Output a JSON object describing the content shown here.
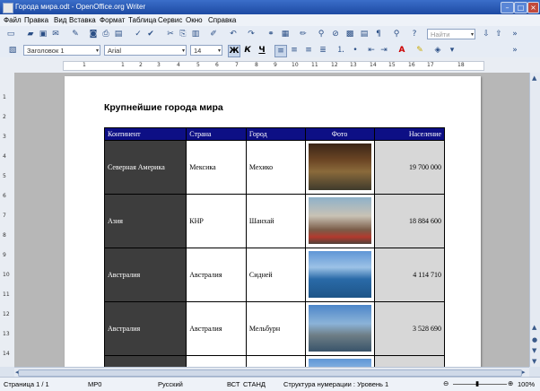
{
  "window": {
    "title": "Города мира.odt - OpenOffice.org Writer"
  },
  "menu": [
    "Файл",
    "Правка",
    "Вид",
    "Вставка",
    "Формат",
    "Таблица",
    "Сервис",
    "Окно",
    "Справка"
  ],
  "toolbar": {
    "find_placeholder": "Найти",
    "style_value": "Заголовок 1",
    "font_value": "Arial",
    "size_value": "14",
    "bold_label": "Ж",
    "italic_label": "К",
    "underline_label": "Ч"
  },
  "ruler": {
    "h_marks": [
      "1",
      "1",
      "2",
      "3",
      "4",
      "5",
      "6",
      "7",
      "8",
      "9",
      "10",
      "11",
      "12",
      "13",
      "14",
      "15",
      "16",
      "17",
      "18"
    ],
    "v_marks": [
      "1",
      "2",
      "3",
      "4",
      "5",
      "6",
      "7",
      "8",
      "9",
      "10",
      "11",
      "12",
      "13",
      "14"
    ]
  },
  "document": {
    "heading": "Крупнейшие города мира",
    "table": {
      "headers": [
        "Континент",
        "Страна",
        "Город",
        "Фото",
        "Население"
      ],
      "rows": [
        {
          "continent": "Северная Америка",
          "country": "Мексика",
          "city": "Мехико",
          "population": "19 700 000"
        },
        {
          "continent": "Азия",
          "country": "КНР",
          "city": "Шанхай",
          "population": "18 884 600"
        },
        {
          "continent": "Австралия",
          "country": "Австралия",
          "city": "Сидней",
          "population": "4 114 710"
        },
        {
          "continent": "Австралия",
          "country": "Австралия",
          "city": "Мельбурн",
          "population": "3 528 690"
        }
      ]
    }
  },
  "status": {
    "page": "Страница 1 / 1",
    "style": "МР0",
    "language": "Русский",
    "insert_mode": "ВСТ",
    "selection_mode": "СТАНД",
    "numbering": "Структура нумерации : Уровень 1",
    "zoom": "100%"
  }
}
